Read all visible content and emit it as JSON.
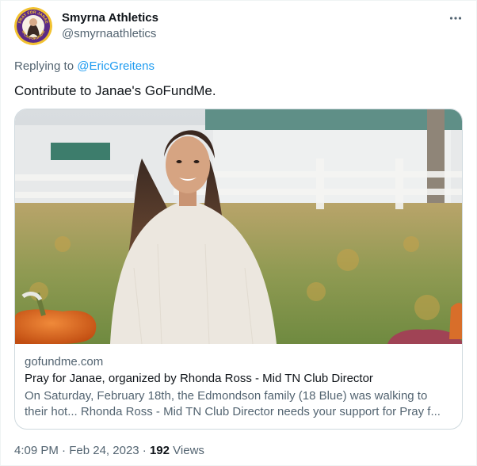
{
  "author": {
    "name": "Smyrna Athletics",
    "handle": "@smyrnaathletics",
    "avatar_icon": "pray-for-janae-logo",
    "avatar_text_top": "PRAY FOR JANAE",
    "avatar_text_bottom": "#PLAYFORJANAE"
  },
  "more_icon": "ellipsis-icon",
  "reply": {
    "prefix": "Replying to ",
    "mention": "@EricGreitens"
  },
  "tweet_text": "Contribute to Janae's GoFundMe.",
  "card": {
    "domain": "gofundme.com",
    "title": "Pray for Janae, organized by Rhonda Ross - Mid TN Club Director",
    "description": "On Saturday, February 18th, the Edmondson family (18 Blue) was walking to their hot... Rhonda Ross - Mid TN Club Director needs your support for Pray f...",
    "image_alt": "photo of young woman in white sweater outdoors near pumpkins"
  },
  "meta": {
    "time": "4:09 PM",
    "separator": " · ",
    "date": "Feb 24, 2023",
    "views_count": "192",
    "views_label": " Views"
  },
  "colors": {
    "link": "#1d9bf0",
    "secondary": "#536471",
    "primary": "#0f1419",
    "avatar_purple": "#5b2a86",
    "avatar_gold": "#f2c230"
  }
}
